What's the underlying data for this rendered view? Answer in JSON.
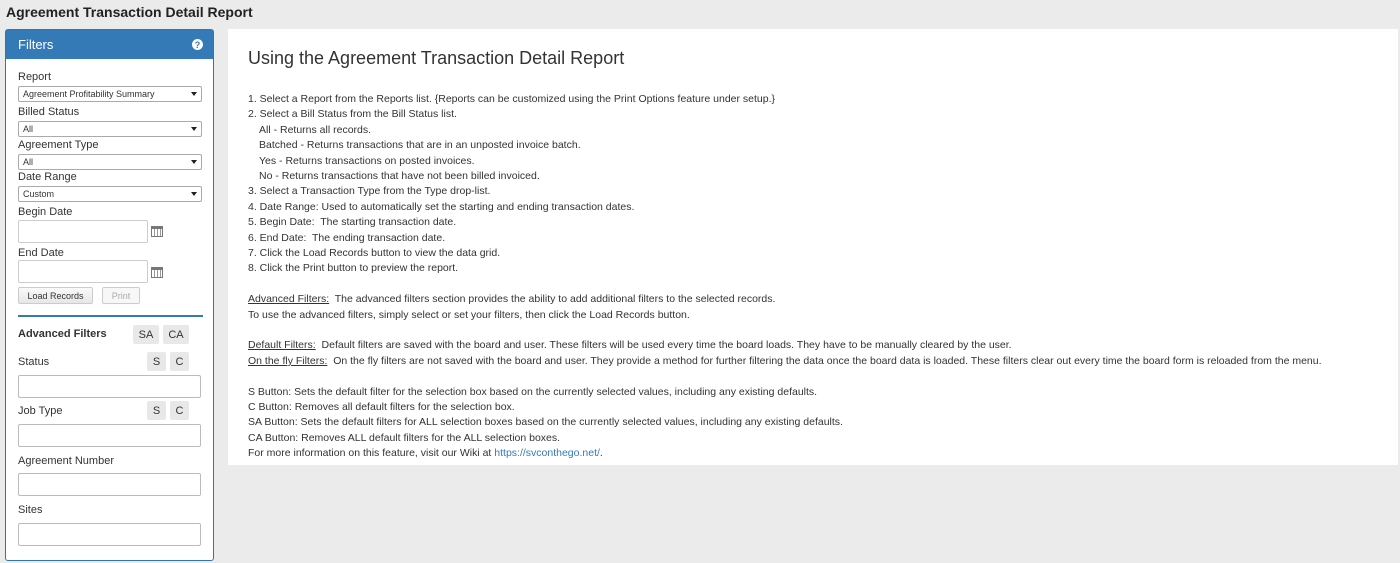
{
  "page_title": "Agreement Transaction Detail Report",
  "filters": {
    "header": "Filters",
    "report_label": "Report",
    "report_value": "Agreement Profitability Summary",
    "billed_status_label": "Billed Status",
    "billed_status_value": "All",
    "agreement_type_label": "Agreement Type",
    "agreement_type_value": "All",
    "date_range_label": "Date Range",
    "date_range_value": "Custom",
    "begin_date_label": "Begin Date",
    "end_date_label": "End Date",
    "load_records_label": "Load Records",
    "print_label": "Print"
  },
  "advanced": {
    "title": "Advanced Filters",
    "sa_label": "SA",
    "ca_label": "CA",
    "s_label": "S",
    "c_label": "C",
    "status_label": "Status",
    "job_type_label": "Job Type",
    "agreement_number_label": "Agreement Number",
    "sites_label": "Sites"
  },
  "main": {
    "title": "Using the Agreement Transaction Detail Report",
    "steps": [
      "1. Select a Report from the Reports list. {Reports can be customized using the Print Options feature under setup.}",
      "2. Select a Bill Status from the Bill Status list."
    ],
    "bill_status_options": [
      "All - Returns all records.",
      "Batched - Returns transactions that are in an unposted invoice batch.",
      "Yes - Returns transactions on posted invoices.",
      "No - Returns transactions that have not been billed invoiced."
    ],
    "steps_rest": [
      "3. Select a Transaction Type from the Type drop-list.",
      "4. Date Range: Used to automatically set the starting and ending transaction dates.",
      "5. Begin Date:  The starting transaction date.",
      "6. End Date:  The ending transaction date.",
      "7. Click the Load Records button to view the data grid.",
      "8. Click the Print button to preview the report."
    ],
    "advanced_filters_term": "Advanced Filters:",
    "advanced_filters_text": "  The advanced filters section provides the ability to add additional filters to the selected records.",
    "advanced_filters_text2": "To use the advanced filters, simply select or set your filters, then click the Load Records button.",
    "default_filters_term": "Default Filters:",
    "default_filters_text": "  Default filters are saved with the board and user. These filters will be used every time the board loads. They have to be manually cleared by the user.",
    "fly_filters_term": "On the fly Filters:",
    "fly_filters_text": "  On the fly filters are not saved with the board and user. They provide a method for further filtering the data once the board data is loaded. These filters clear out every time the board form is reloaded from the menu.",
    "button_notes": [
      "S Button: Sets the default filter for the selection box based on the currently selected values, including any existing defaults.",
      "C Button: Removes all default filters for the selection box.",
      "SA Button: Sets the default filters for ALL selection boxes based on the currently selected values, including any existing defaults.",
      "CA Button: Removes ALL default filters for the ALL selection boxes."
    ],
    "wiki_text": "For more information on this feature, visit our Wiki at ",
    "wiki_link": "https://svconthego.net/",
    "wiki_end": "."
  }
}
